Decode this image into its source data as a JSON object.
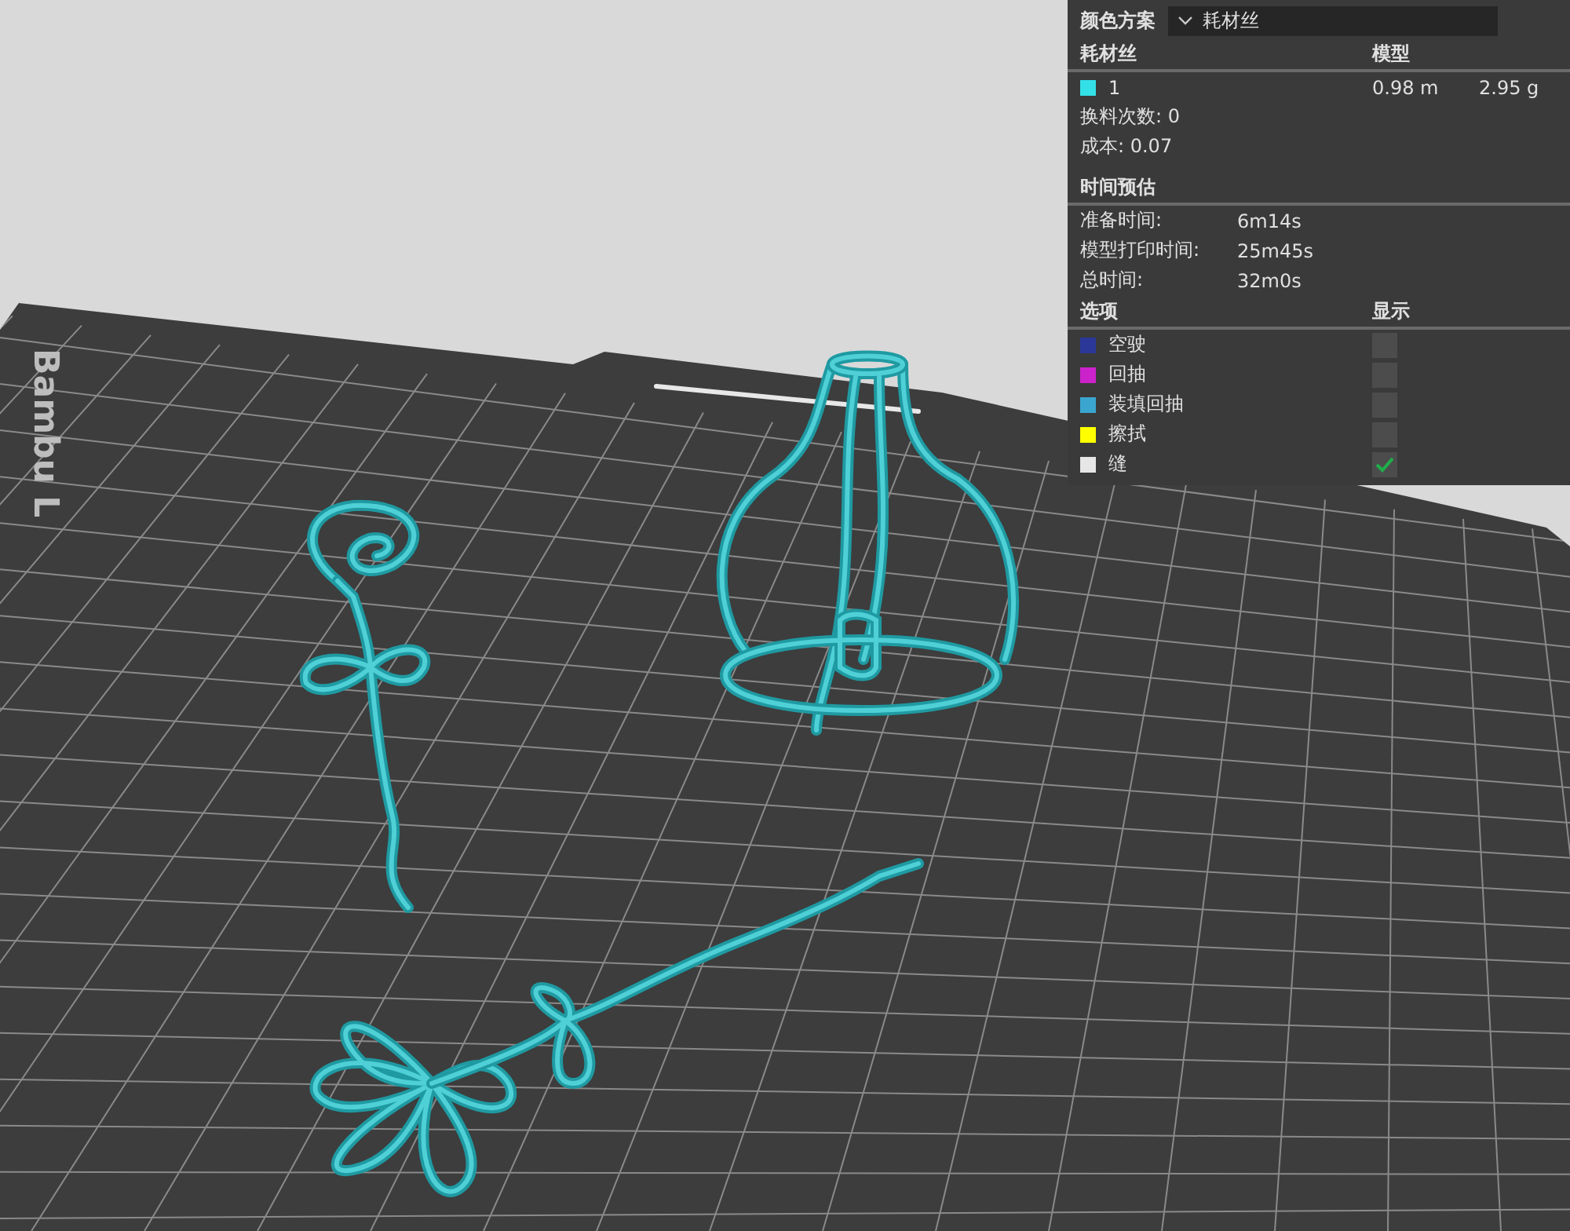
{
  "color_scheme": {
    "label": "颜色方案",
    "value": "耗材丝"
  },
  "filament": {
    "columns": [
      "耗材丝",
      "模型"
    ],
    "rows": [
      {
        "color": "#33e0e8",
        "name": "1",
        "length": "0.98 m",
        "weight": "2.95 g"
      }
    ],
    "changes": "换料次数: 0",
    "cost": "成本: 0.07"
  },
  "time_estimate": {
    "title": "时间预估",
    "rows": [
      {
        "label": "准备时间:",
        "value": "6m14s"
      },
      {
        "label": "模型打印时间:",
        "value": "25m45s"
      },
      {
        "label": "总时间:",
        "value": "32m0s"
      }
    ]
  },
  "options": {
    "columns": [
      "选项",
      "显示"
    ],
    "items": [
      {
        "label": "空驶",
        "color": "#2b3899",
        "checked": false
      },
      {
        "label": "回抽",
        "color": "#cc22cc",
        "checked": false
      },
      {
        "label": "装填回抽",
        "color": "#3aa6d0",
        "checked": false
      },
      {
        "label": "擦拭",
        "color": "#ffff00",
        "checked": false
      },
      {
        "label": "缝",
        "color": "#e6e6e6",
        "checked": true
      }
    ]
  },
  "bed": {
    "logo": "Bambu L"
  }
}
